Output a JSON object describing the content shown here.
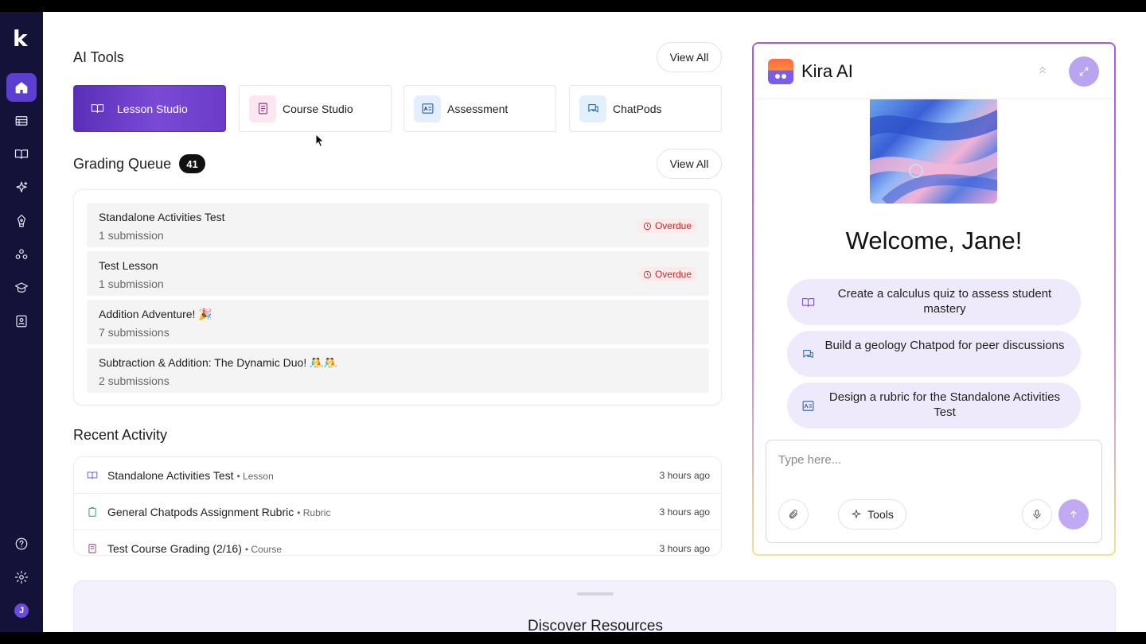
{
  "ai_tools": {
    "title": "AI Tools",
    "view_all": "View All",
    "cards": [
      {
        "label": "Lesson Studio",
        "icon": "book-open-icon",
        "active": true
      },
      {
        "label": "Course Studio",
        "icon": "notebook-icon",
        "active": false
      },
      {
        "label": "Assessment",
        "icon": "assessment-icon",
        "active": false
      },
      {
        "label": "ChatPods",
        "icon": "chat-bubbles-icon",
        "active": false
      }
    ]
  },
  "grading_queue": {
    "title": "Grading Queue",
    "count": "41",
    "view_all": "View All",
    "items": [
      {
        "title": "Standalone Activities Test",
        "subtitle": "1 submission",
        "status": "Overdue"
      },
      {
        "title": "Test Lesson",
        "subtitle": "1 submission",
        "status": "Overdue"
      },
      {
        "title": "Addition Adventure! 🎉",
        "subtitle": "7 submissions",
        "status": ""
      },
      {
        "title": "Subtraction & Addition: The Dynamic Duo! 🤼🤼",
        "subtitle": "2 submissions",
        "status": ""
      }
    ]
  },
  "recent_activity": {
    "title": "Recent Activity",
    "items": [
      {
        "title": "Standalone Activities Test",
        "type": "• Lesson",
        "time": "3 hours ago",
        "icon": "book-open-icon"
      },
      {
        "title": "General Chatpods Assignment Rubric",
        "type": "• Rubric",
        "time": "3 hours ago",
        "icon": "clipboard-icon"
      },
      {
        "title": "Test Course Grading (2/16)",
        "type": "• Course",
        "time": "3 hours ago",
        "icon": "notebook-icon"
      }
    ]
  },
  "discover": {
    "title": "Discover Resources"
  },
  "kira": {
    "title": "Kira AI",
    "welcome": "Welcome, Jane!",
    "suggestions": [
      {
        "text": "Create a calculus quiz to assess student mastery",
        "icon": "book-open-icon"
      },
      {
        "text": "Build a geology Chatpod for peer discussions",
        "icon": "chat-bubbles-icon"
      },
      {
        "text": "Design a rubric for the Standalone Activities Test",
        "icon": "assessment-icon"
      }
    ],
    "input_placeholder": "Type here...",
    "tools_label": "Tools"
  },
  "user": {
    "initial": "J"
  },
  "colors": {
    "sidebar": "#15123a",
    "accent": "#5c3fd1",
    "overdue": "#c62828",
    "suggestion_bg": "#efeafb"
  }
}
